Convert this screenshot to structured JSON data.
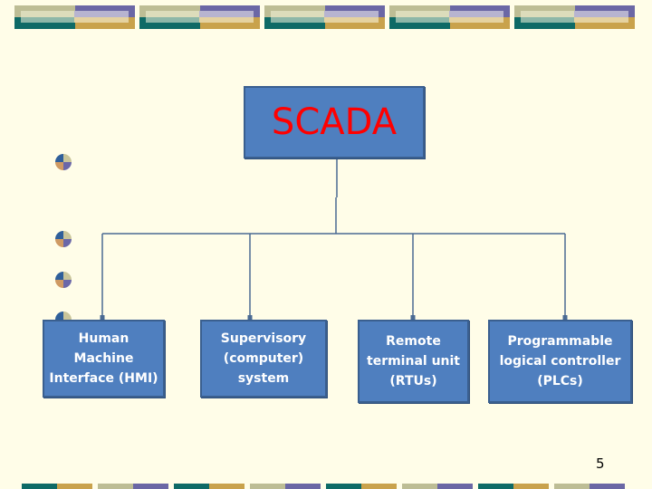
{
  "slide": {
    "page_number": "5",
    "colors": {
      "background": "#fffde8",
      "box_fill": "#4f7fbf",
      "box_border": "#3a5f8f",
      "root_text": "#ff0000",
      "child_text": "#ffffff",
      "connector": "#4a6a93"
    }
  },
  "diagram": {
    "root": {
      "label": "SCADA"
    },
    "children": [
      {
        "label": "Human\nMachine\nInterface  (HMI)"
      },
      {
        "label": "Supervisory\n(computer)\nsystem"
      },
      {
        "label": "Remote\nterminal unit\n(RTUs)"
      },
      {
        "label": "Programmable\nlogical controller\n(PLCs)"
      }
    ]
  },
  "decor": {
    "banner_blocks": 5,
    "footer_segments": 8,
    "bullets": 4,
    "bullet_icon": "quartered-circle-bullet-icon"
  }
}
